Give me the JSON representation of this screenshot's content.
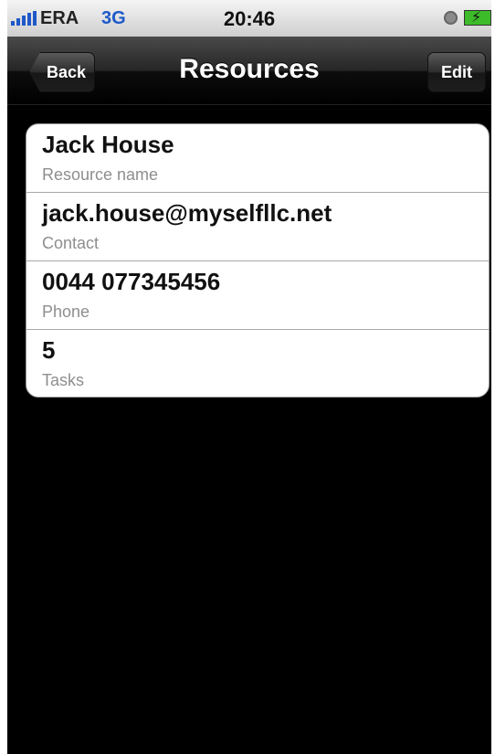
{
  "status_bar": {
    "carrier": "ERA",
    "network": "3G",
    "time": "20:46",
    "icons": [
      "signal-bars-icon",
      "alarm-icon",
      "battery-charging-icon"
    ]
  },
  "nav": {
    "title": "Resources",
    "back_label": "Back",
    "edit_label": "Edit"
  },
  "rows": [
    {
      "value": "Jack House",
      "label": "Resource name"
    },
    {
      "value": "jack.house@myselfllc.net",
      "label": "Contact"
    },
    {
      "value": "0044 077345456",
      "label": "Phone"
    },
    {
      "value": "5",
      "label": "Tasks"
    }
  ],
  "colors": {
    "network_blue": "#1f59c9",
    "battery_green": "#3dbb2a",
    "label_gray": "#8e8e8e"
  }
}
